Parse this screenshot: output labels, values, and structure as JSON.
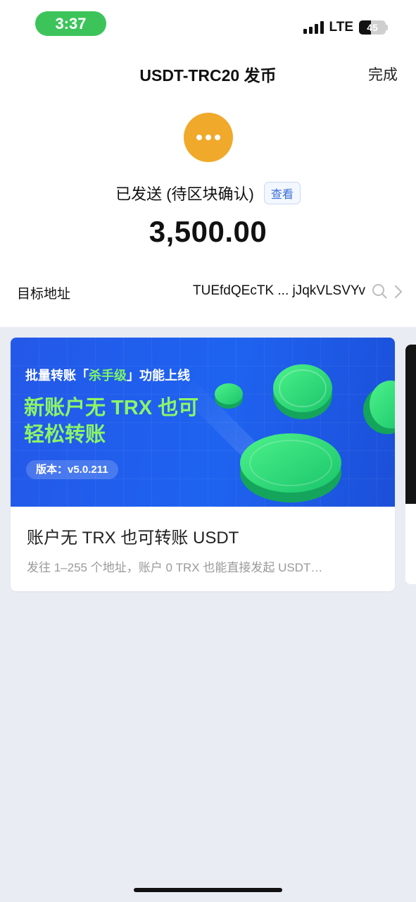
{
  "status_bar": {
    "time": "3:37",
    "network": "LTE",
    "battery": "45",
    "battery_level": 0.45
  },
  "nav": {
    "title": "USDT-TRC20 发币",
    "done_label": "完成"
  },
  "status": {
    "text": "已发送 (待区块确认)",
    "view_label": "查看",
    "icon": "more-dots-icon",
    "color": "#f0a92a"
  },
  "amount": "3,500.00",
  "address": {
    "label": "目标地址",
    "value": "TUEfdQEcTK ... jJqkVLSVYv"
  },
  "promo": {
    "line1_prefix": "批量转账「",
    "line1_highlight": "杀手级",
    "line1_suffix": "」功能上线",
    "line2": "新账户无 TRX 也可",
    "line3": "轻松转账",
    "version": "版本：v5.0.211",
    "title": "账户无 TRX 也可转账 USDT",
    "description": "发往 1–255 个地址，账户 0 TRX 也能直接发起 USDT…"
  },
  "colors": {
    "accent": "#3a6fd8",
    "banner": "#1e63f0",
    "highlight": "#8cf567",
    "time_pill": "#3cc45a"
  }
}
